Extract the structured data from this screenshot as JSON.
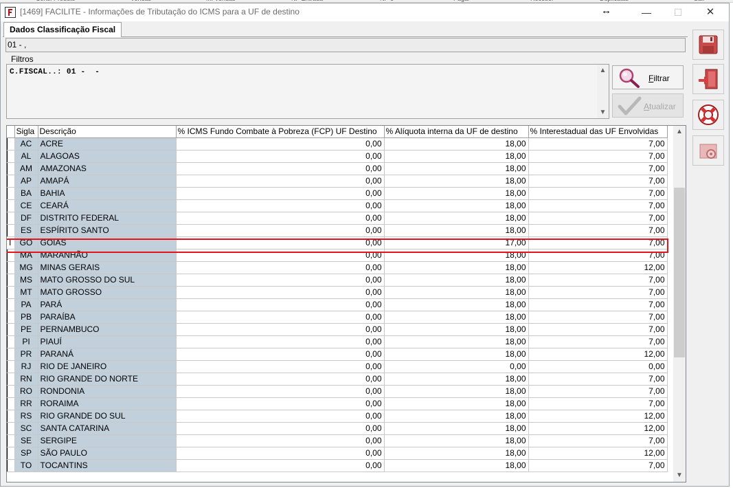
{
  "background_menu": [
    "Cons. Produto",
    "Vendas",
    "M. Vendas",
    "NF Entrada",
    "NF-e",
    "Pagar",
    "Receber",
    "Duplicatas",
    "Sair"
  ],
  "window": {
    "title": "[1469] FACILITE - Informações de Tributação do ICMS para a UF de destino",
    "minimize": "—",
    "maximize": "☐",
    "close": "✕",
    "resize_glyph": "↔"
  },
  "tab": {
    "label": "Dados Classificação Fiscal"
  },
  "code_bar": {
    "value": "01 - ,"
  },
  "filters": {
    "label": "Filtros",
    "text": "C.FISCAL..: 01 -  -",
    "scroll_up": "▲",
    "scroll_down": "▼"
  },
  "buttons": {
    "filtrar_mnemonic": "F",
    "filtrar_rest": "iltrar",
    "atualizar_mnemonic": "A",
    "atualizar_rest": "tualizar"
  },
  "side_buttons": [
    "save-icon",
    "exit-door-icon",
    "help-lifebuoy-icon",
    "settings-icon"
  ],
  "grid": {
    "columns": [
      "Sigla",
      "Descrição",
      "% ICMS Fundo Combate à Pobreza (FCP) UF Destino",
      "% Alíquota interna da UF de destino",
      "% Interestadual das UF Envolvidas"
    ],
    "selected_indicator": "I",
    "rows": [
      {
        "sigla": "AC",
        "desc": "ACRE",
        "fcp": "0,00",
        "aliq": "18,00",
        "inter": "7,00"
      },
      {
        "sigla": "AL",
        "desc": "ALAGOAS",
        "fcp": "0,00",
        "aliq": "18,00",
        "inter": "7,00"
      },
      {
        "sigla": "AM",
        "desc": "AMAZONAS",
        "fcp": "0,00",
        "aliq": "18,00",
        "inter": "7,00"
      },
      {
        "sigla": "AP",
        "desc": "AMAPÁ",
        "fcp": "0,00",
        "aliq": "18,00",
        "inter": "7,00"
      },
      {
        "sigla": "BA",
        "desc": "BAHIA",
        "fcp": "0,00",
        "aliq": "18,00",
        "inter": "7,00"
      },
      {
        "sigla": "CE",
        "desc": "CEARÁ",
        "fcp": "0,00",
        "aliq": "18,00",
        "inter": "7,00"
      },
      {
        "sigla": "DF",
        "desc": "DISTRITO FEDERAL",
        "fcp": "0,00",
        "aliq": "18,00",
        "inter": "7,00"
      },
      {
        "sigla": "ES",
        "desc": "ESPÍRITO SANTO",
        "fcp": "0,00",
        "aliq": "18,00",
        "inter": "7,00"
      },
      {
        "sigla": "GO",
        "desc": "GOIAS",
        "fcp": "0,00",
        "aliq": "17,00",
        "inter": "7,00"
      },
      {
        "sigla": "MA",
        "desc": "MARANHÃO",
        "fcp": "0,00",
        "aliq": "18,00",
        "inter": "7,00"
      },
      {
        "sigla": "MG",
        "desc": "MINAS GERAIS",
        "fcp": "0,00",
        "aliq": "18,00",
        "inter": "12,00"
      },
      {
        "sigla": "MS",
        "desc": "MATO GROSSO DO SUL",
        "fcp": "0,00",
        "aliq": "18,00",
        "inter": "7,00"
      },
      {
        "sigla": "MT",
        "desc": "MATO GROSSO",
        "fcp": "0,00",
        "aliq": "18,00",
        "inter": "7,00"
      },
      {
        "sigla": "PA",
        "desc": "PARÁ",
        "fcp": "0,00",
        "aliq": "18,00",
        "inter": "7,00"
      },
      {
        "sigla": "PB",
        "desc": "PARAÍBA",
        "fcp": "0,00",
        "aliq": "18,00",
        "inter": "7,00"
      },
      {
        "sigla": "PE",
        "desc": "PERNAMBUCO",
        "fcp": "0,00",
        "aliq": "18,00",
        "inter": "7,00"
      },
      {
        "sigla": "PI",
        "desc": "PIAUÍ",
        "fcp": "0,00",
        "aliq": "18,00",
        "inter": "7,00"
      },
      {
        "sigla": "PR",
        "desc": "PARANÁ",
        "fcp": "0,00",
        "aliq": "18,00",
        "inter": "12,00"
      },
      {
        "sigla": "RJ",
        "desc": "RIO DE JANEIRO",
        "fcp": "0,00",
        "aliq": "0,00",
        "inter": "0,00"
      },
      {
        "sigla": "RN",
        "desc": "RIO GRANDE DO NORTE",
        "fcp": "0,00",
        "aliq": "18,00",
        "inter": "7,00"
      },
      {
        "sigla": "RO",
        "desc": "RONDONIA",
        "fcp": "0,00",
        "aliq": "18,00",
        "inter": "7,00"
      },
      {
        "sigla": "RR",
        "desc": "RORAIMA",
        "fcp": "0,00",
        "aliq": "18,00",
        "inter": "7,00"
      },
      {
        "sigla": "RS",
        "desc": "RIO GRANDE DO SUL",
        "fcp": "0,00",
        "aliq": "18,00",
        "inter": "12,00"
      },
      {
        "sigla": "SC",
        "desc": "SANTA CATARINA",
        "fcp": "0,00",
        "aliq": "18,00",
        "inter": "12,00"
      },
      {
        "sigla": "SE",
        "desc": "SERGIPE",
        "fcp": "0,00",
        "aliq": "18,00",
        "inter": "7,00"
      },
      {
        "sigla": "SP",
        "desc": "SÃO PAULO",
        "fcp": "0,00",
        "aliq": "18,00",
        "inter": "12,00"
      },
      {
        "sigla": "TO",
        "desc": "TOCANTINS",
        "fcp": "0,00",
        "aliq": "18,00",
        "inter": "7,00"
      }
    ],
    "scroll_up": "▲",
    "scroll_down": "▼"
  },
  "colors": {
    "key_column_bg": "#c2d0dc",
    "highlight_border": "#e0141a"
  }
}
